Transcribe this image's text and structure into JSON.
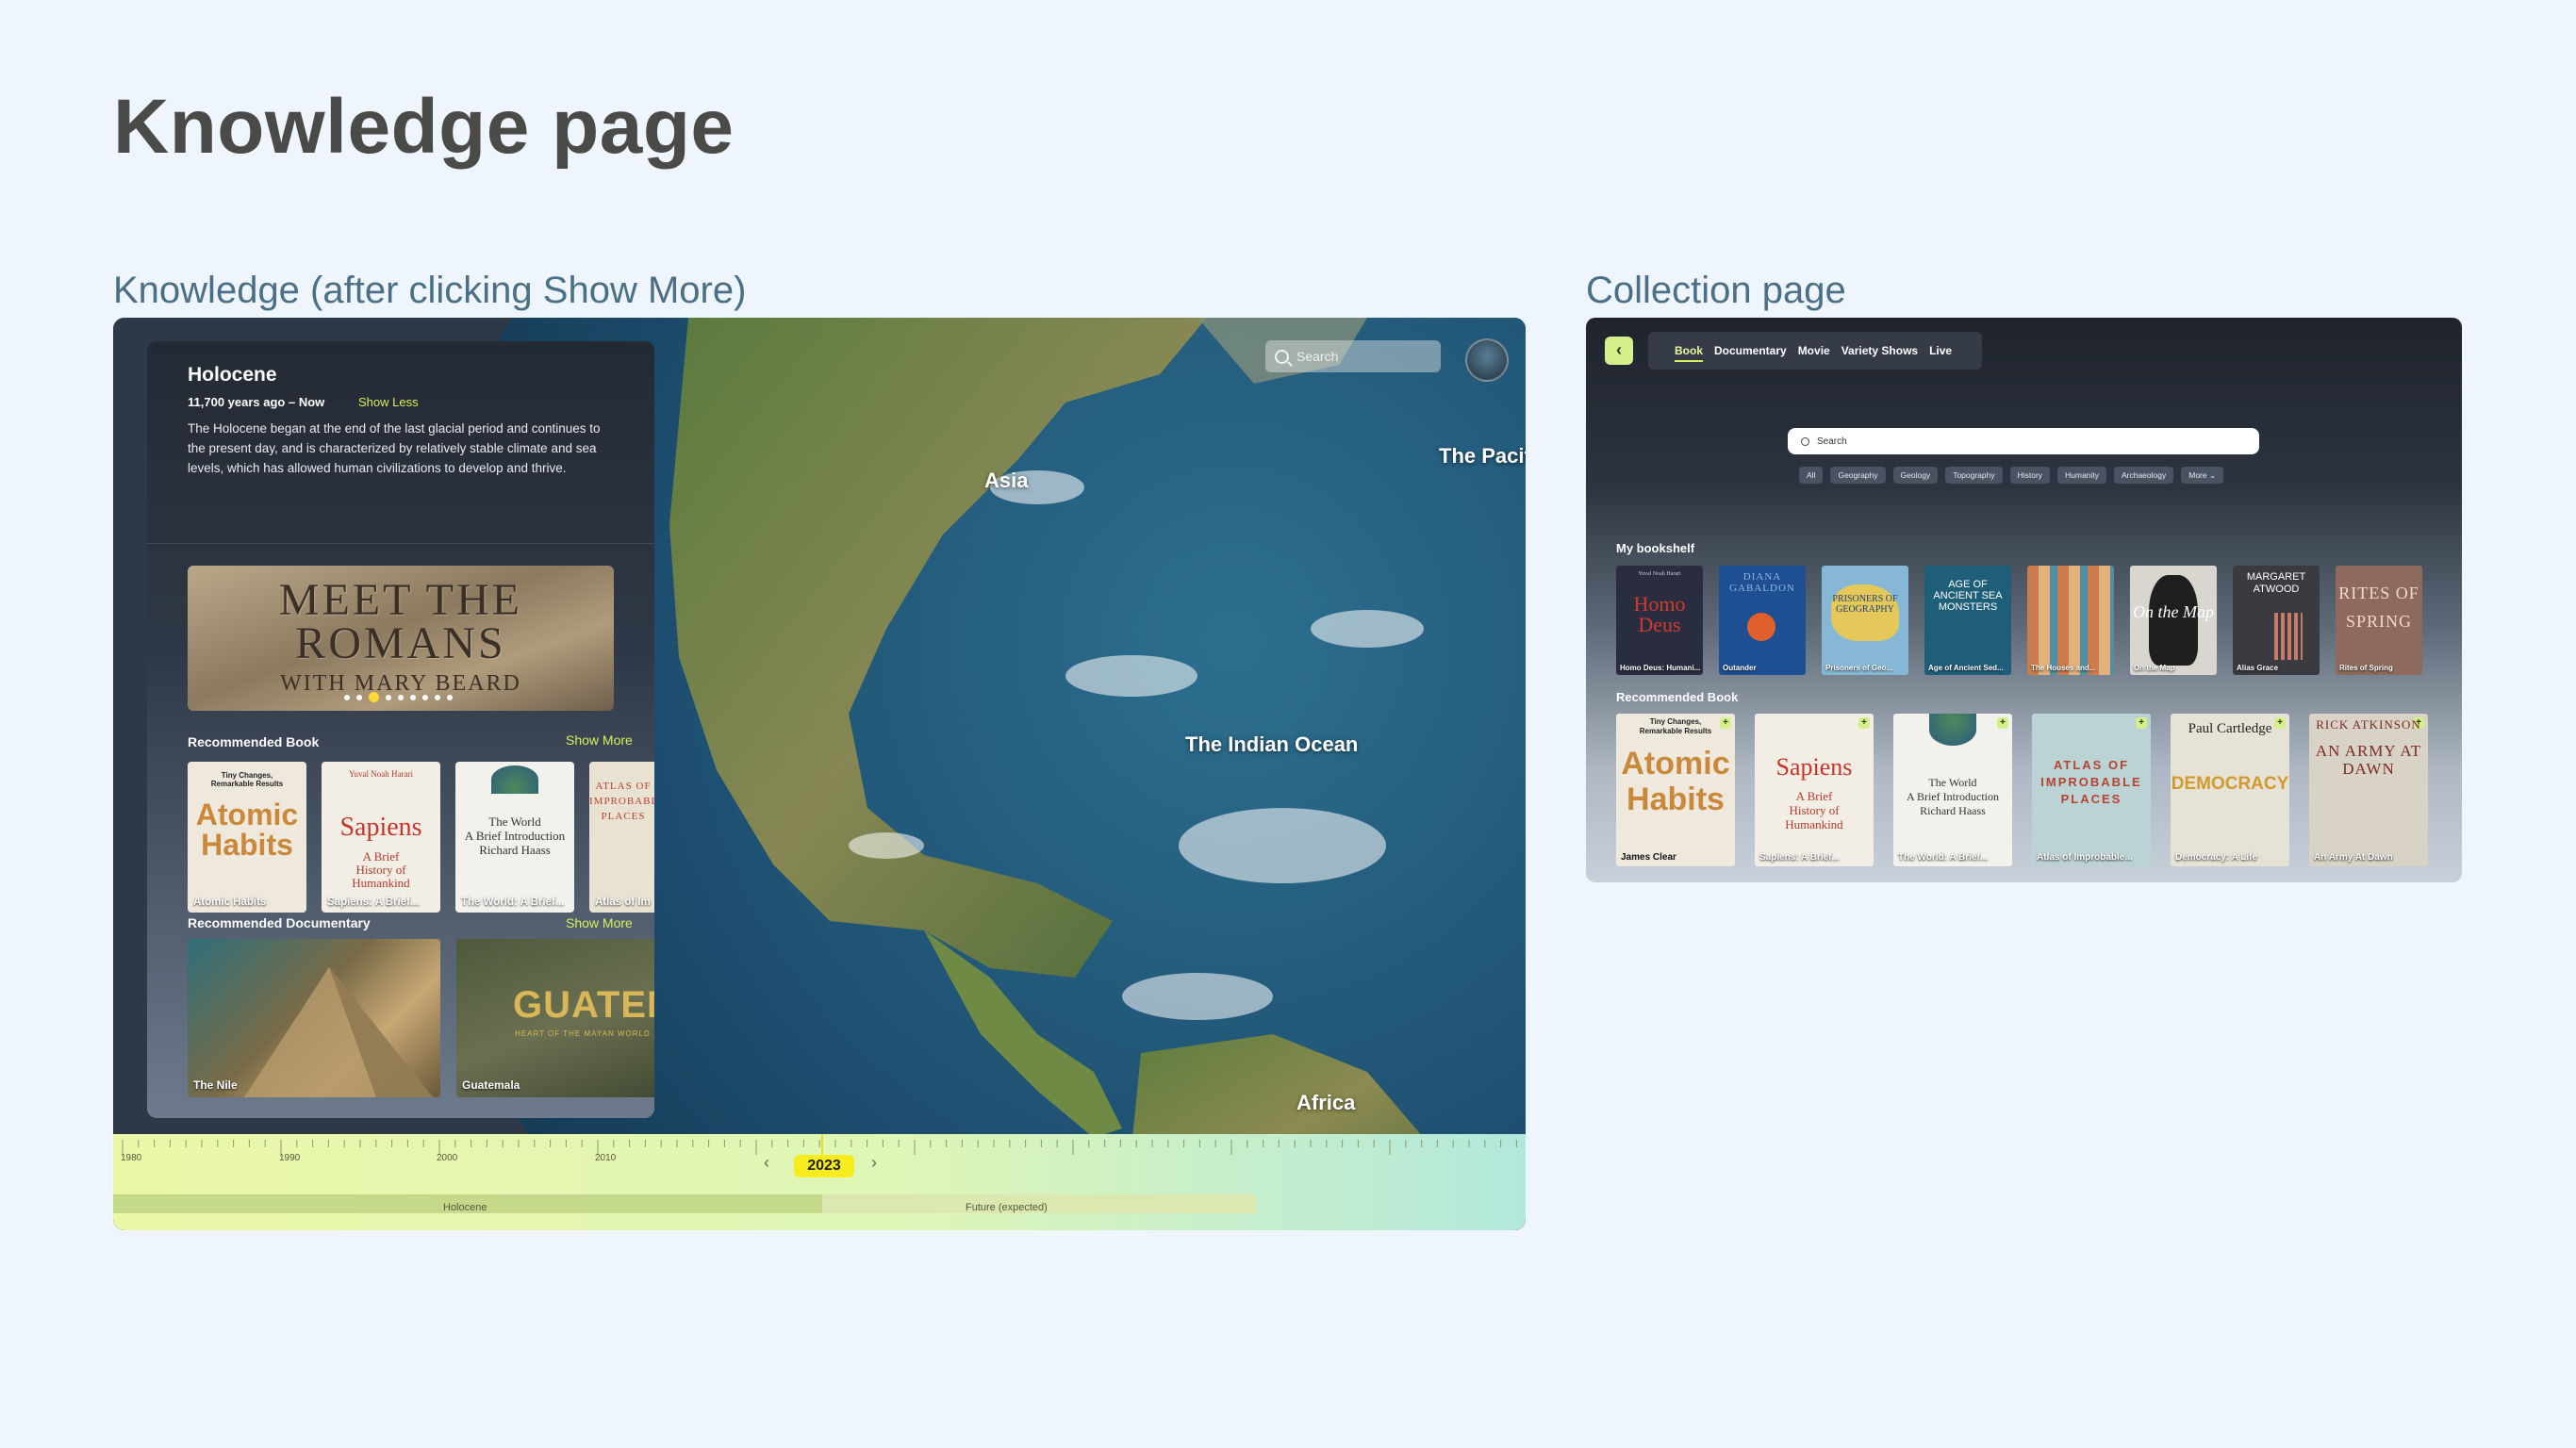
{
  "page": {
    "title": "Knowledge page",
    "left_section_label": "Knowledge (after clicking Show More)",
    "right_section_label": "Collection page"
  },
  "knowledge": {
    "search_placeholder": "Search",
    "map_labels": {
      "asia": "Asia",
      "pacific": "The Pacific",
      "indian": "The Indian Ocean",
      "africa": "Africa"
    },
    "era": {
      "title": "Holocene",
      "range": "11,700 years ago – Now",
      "show_less": "Show Less",
      "description": "The Holocene began at the end of the last glacial period and continues to the present day, and is characterized by relatively stable climate and sea levels, which has allowed human civilizations to develop and thrive."
    },
    "banner": {
      "title_line1": "MEET THE",
      "title_line2": "ROMANS",
      "subtitle": "WITH MARY BEARD",
      "slide_count": 9,
      "active_slide": 2
    },
    "recommended_book": {
      "heading": "Recommended Book",
      "show_more": "Show More",
      "items": [
        {
          "label": "Atomic Habits",
          "cover": "Atomic Habits",
          "color": "#efe9dd"
        },
        {
          "label": "Sapiens: A Brief...",
          "cover": "Sapiens",
          "color": "#f2eee6"
        },
        {
          "label": "The World: A Brief...",
          "cover": "The World",
          "color": "#f3f1ec"
        },
        {
          "label": "Atlas of Im",
          "cover": "ATLAS OF IMPROBABLE PLACES",
          "color": "#e9e2d3"
        }
      ]
    },
    "recommended_documentary": {
      "heading": "Recommended Documentary",
      "show_more": "Show More",
      "items": [
        {
          "label": "The Nile",
          "cover": ""
        },
        {
          "label": "Guatemala",
          "cover": "GUATEMALA",
          "sub": "HEART OF THE MAYAN WORLD"
        }
      ]
    },
    "timeline": {
      "ticks": [
        "1980",
        "1990",
        "2000",
        "2010"
      ],
      "current_year": "2023",
      "eras": [
        "Holocene",
        "Future (expected)"
      ]
    }
  },
  "collection": {
    "back_icon": "chevron-left-icon",
    "tabs": [
      "Book",
      "Documentary",
      "Movie",
      "Variety Shows",
      "Live"
    ],
    "active_tab": "Book",
    "search_placeholder": "Search",
    "filters": [
      "All",
      "Geography",
      "Geology",
      "Topography",
      "History",
      "Humanity",
      "Archaeology",
      "More"
    ],
    "bookshelf": {
      "heading": "My bookshelf",
      "items": [
        {
          "label": "Homo Deus: Humani...",
          "cover": "Homo Deus",
          "color": "#2a2c40"
        },
        {
          "label": "Outander",
          "cover": "DIANA GABALDON",
          "color": "#1f4f93"
        },
        {
          "label": "Prisoners of Geo...",
          "cover": "PRISONERS OF GEOGRAPHY",
          "color": "#86b8d6"
        },
        {
          "label": "Age of Ancient Sed...",
          "cover": "AGE OF ANCIENT SEA MONSTERS",
          "color": "#1f5e79"
        },
        {
          "label": "The Houses and...",
          "cover": "",
          "color": "#c97c4d"
        },
        {
          "label": "On the Map",
          "cover": "On the Map",
          "color": "#d9d6cf"
        },
        {
          "label": "Alias Grace",
          "cover": "MARGARET ATWOOD",
          "color": "#3a3b40"
        },
        {
          "label": "Rites of Spring",
          "cover": "RITES OF SPRING",
          "color": "#8d6a5c"
        }
      ]
    },
    "recommended": {
      "heading": "Recommended Book",
      "items": [
        {
          "label": "James Clear",
          "cover": "Atomic Habits"
        },
        {
          "label": "Sapiens: A Brief...",
          "cover": "Sapiens"
        },
        {
          "label": "The World: A Brief...",
          "cover": "The World"
        },
        {
          "label": "Atlas of Improbable...",
          "cover": "ATLAS OF IMPROBABLE PLACES"
        },
        {
          "label": "Democracy: A Life",
          "cover": "DEMOCRACY"
        },
        {
          "label": "An Army At Dawn",
          "cover": "AN ARMY AT DAWN"
        }
      ]
    }
  }
}
